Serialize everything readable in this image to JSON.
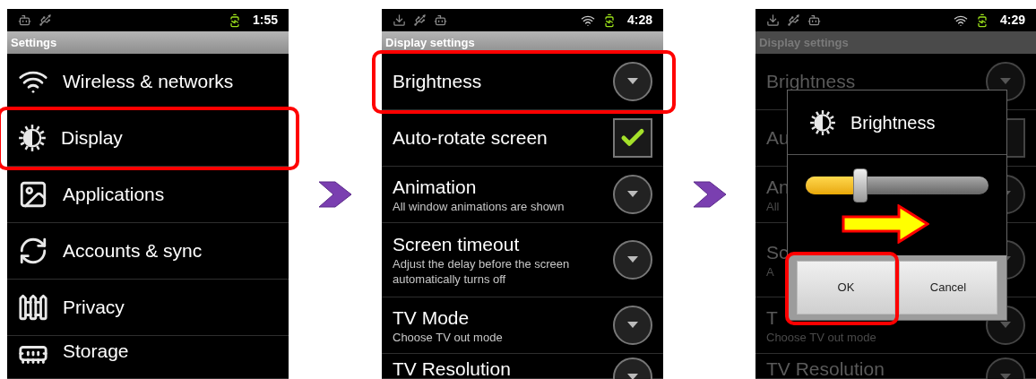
{
  "screens": [
    {
      "status_bar": {
        "time": "1:55"
      },
      "title": "Settings",
      "dimmed": false,
      "items": [
        {
          "kind": "nav",
          "label": "Wireless & networks",
          "highlighted": false
        },
        {
          "kind": "nav",
          "label": "Display",
          "highlighted": true
        },
        {
          "kind": "nav",
          "label": "Applications",
          "highlighted": false
        },
        {
          "kind": "nav",
          "label": "Accounts & sync",
          "highlighted": false
        },
        {
          "kind": "nav",
          "label": "Privacy",
          "highlighted": false
        },
        {
          "kind": "nav",
          "label": "Storage",
          "highlighted": false
        }
      ]
    },
    {
      "status_bar": {
        "time": "4:28"
      },
      "title": "Display settings",
      "dimmed": false,
      "items": [
        {
          "kind": "dropdown",
          "label": "Brightness",
          "highlighted": true
        },
        {
          "kind": "checkbox",
          "label": "Auto-rotate screen",
          "checked": true,
          "highlighted": false
        },
        {
          "kind": "dropdown",
          "label": "Animation",
          "subtitle": "All window animations are shown",
          "highlighted": false
        },
        {
          "kind": "dropdown",
          "label": "Screen timeout",
          "subtitle": "Adjust the delay before the screen automatically turns off",
          "highlighted": false
        },
        {
          "kind": "dropdown",
          "label": "TV Mode",
          "subtitle": "Choose TV out mode",
          "highlighted": false
        },
        {
          "kind": "dropdown",
          "label": "TV Resolution",
          "highlighted": false
        }
      ]
    },
    {
      "status_bar": {
        "time": "4:29"
      },
      "title": "Display settings",
      "dimmed": true,
      "items": [
        {
          "kind": "dropdown",
          "label": "Brightness",
          "highlighted": false
        },
        {
          "kind": "checkbox",
          "label": "Au",
          "checked": false,
          "highlighted": false
        },
        {
          "kind": "dropdown",
          "label": "An",
          "subtitle": "All",
          "highlighted": false
        },
        {
          "kind": "dropdown",
          "label": "Sc",
          "subtitle": "A",
          "highlighted": false
        },
        {
          "kind": "dropdown",
          "label": "T",
          "subtitle": "Choose TV out mode",
          "highlighted": false
        },
        {
          "kind": "dropdown",
          "label": "TV Resolution",
          "highlighted": false
        }
      ],
      "dialog": {
        "title": "Brightness",
        "slider": {
          "level": 0.3
        },
        "buttons": [
          {
            "label": "OK",
            "highlighted": true
          },
          {
            "label": "Cancel",
            "highlighted": false
          }
        ]
      }
    }
  ]
}
